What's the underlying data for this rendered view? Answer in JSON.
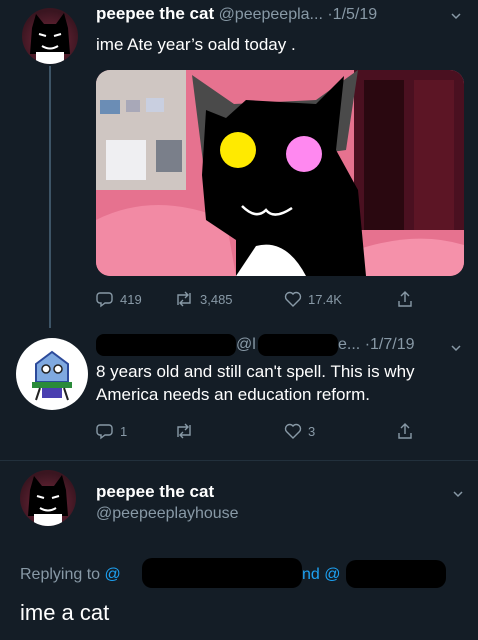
{
  "tweet1": {
    "name": "peepee the cat",
    "handle": "@peepeepla...",
    "sep_date": "·1/5/19",
    "text": "ime Ate year’s oald today .",
    "stats": {
      "replies": "419",
      "retweets": "3,485",
      "likes": "17.4K"
    },
    "icons": [
      "reply-icon",
      "retweet-icon",
      "like-icon",
      "share-icon"
    ]
  },
  "tweet2": {
    "handle_start": "@l",
    "handle_end": "e...",
    "sep_date": "·1/7/19",
    "text": "8 years old and still can't spell. This is why America needs an education reform.",
    "stats": {
      "replies": "1",
      "retweets": "",
      "likes": "3"
    }
  },
  "tweet3": {
    "name": "peepee the cat",
    "handle": "@peepeeplayhouse",
    "replying_prefix": "Replying to",
    "replying_at1": "@",
    "replying_mid": "nd",
    "replying_at2": "@",
    "text": "ime a cat"
  },
  "colors": {
    "background": "#141d26",
    "secondary_text": "#8899a6",
    "accent": "#1da1f2",
    "photo_bg": "#e6728f"
  }
}
